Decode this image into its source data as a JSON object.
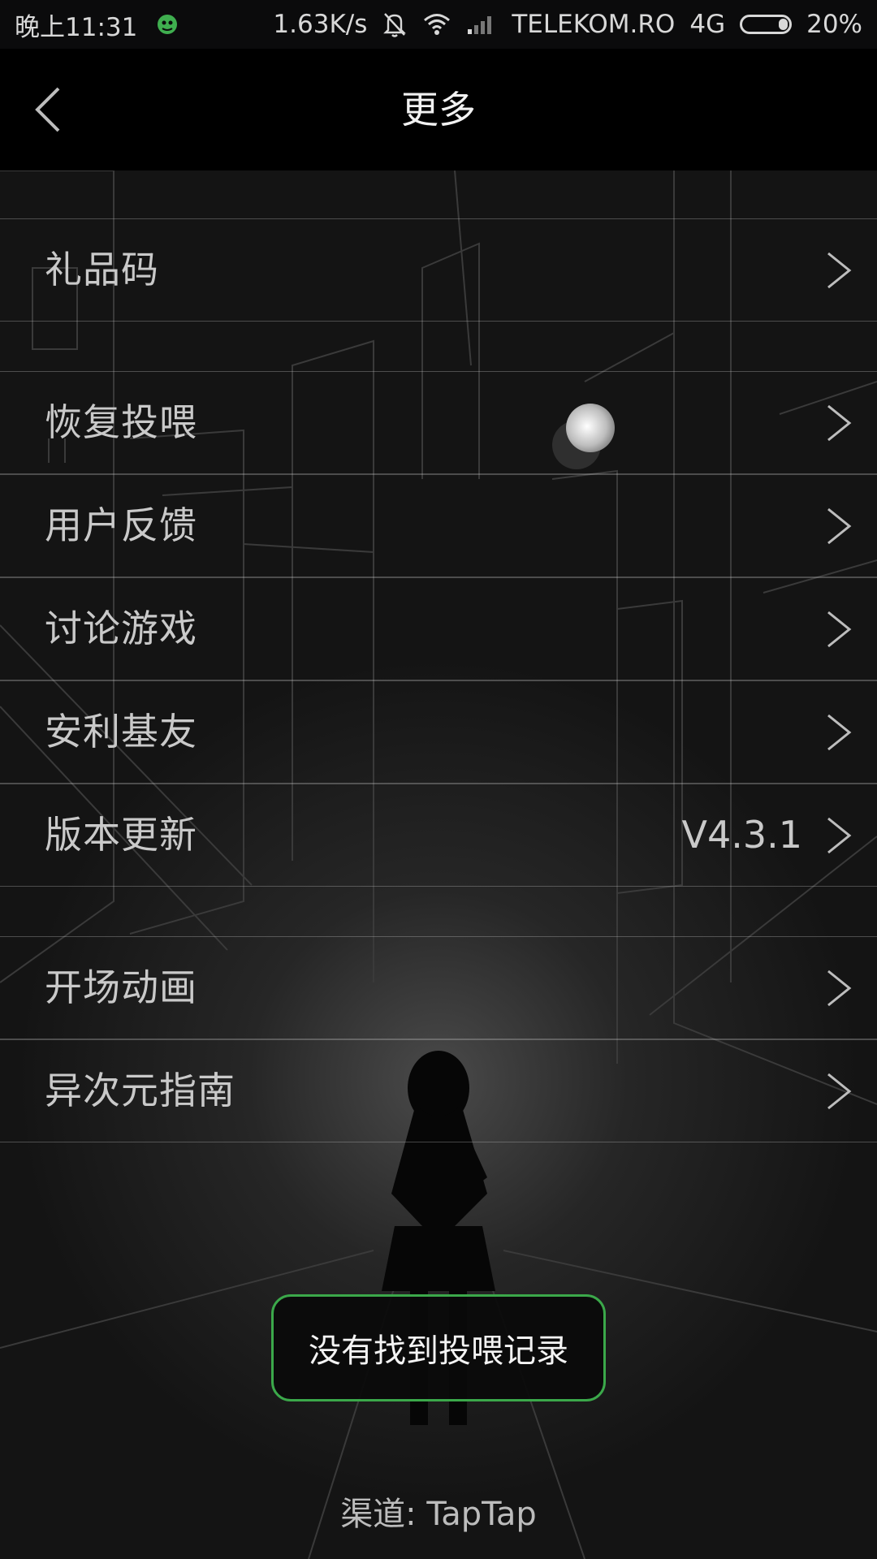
{
  "status_bar": {
    "time": "晚上11:31",
    "speed": "1.63K/s",
    "carrier": "TELEKOM.RO",
    "network": "4G",
    "battery_text": "20%",
    "battery_level": 0.2
  },
  "header": {
    "title": "更多"
  },
  "menu": {
    "items": [
      {
        "label": "礼品码",
        "value": ""
      },
      {
        "label": "恢复投喂",
        "value": ""
      },
      {
        "label": "用户反馈",
        "value": ""
      },
      {
        "label": "讨论游戏",
        "value": ""
      },
      {
        "label": "安利基友",
        "value": ""
      },
      {
        "label": "版本更新",
        "value": "V4.3.1"
      },
      {
        "label": "开场动画",
        "value": ""
      },
      {
        "label": "异次元指南",
        "value": ""
      }
    ]
  },
  "toast": {
    "text": "没有找到投喂记录"
  },
  "footer": {
    "channel": "渠道: TapTap"
  },
  "colors": {
    "toast_border": "#3ba84a",
    "header_bg": "#000000",
    "text": "#c9c9c9"
  }
}
